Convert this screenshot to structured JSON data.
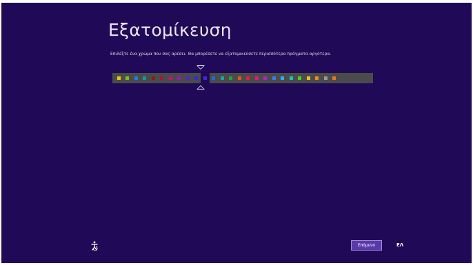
{
  "title": "Εξατομίκευση",
  "instruction": "Επιλέξτε ένα χρώμα που σας αρέσει. Θα μπορέσετε να εξατομικεύσετε περισσότερα πράγματα αργότερα.",
  "colors": {
    "background": "#200a57",
    "palette_strip": "#4b4b4b",
    "button": "#5a3aa9"
  },
  "palette": {
    "selected_index": 10,
    "swatches": [
      "#f2c210",
      "#7bc417",
      "#1e7fe0",
      "#0f9a95",
      "#8b1a1a",
      "#a8143c",
      "#c1156f",
      "#9b1bb0",
      "#4b2cc7",
      "#2a2fd3",
      "#3f2ad8",
      "#1a6fd6",
      "#18a7a0",
      "#2b9d3a",
      "#e35a12",
      "#e81e3c",
      "#e2187f",
      "#b521c8",
      "#3a7af0",
      "#2ab0f0",
      "#19c4b0",
      "#46d21c",
      "#e8c21a",
      "#f28c13",
      "#9a9a9a",
      "#e07a1a"
    ]
  },
  "buttons": {
    "next_label": "Επόμενο"
  },
  "language": "ΕΛ",
  "icons": {
    "ease_of_access": "ease-of-access-icon"
  }
}
